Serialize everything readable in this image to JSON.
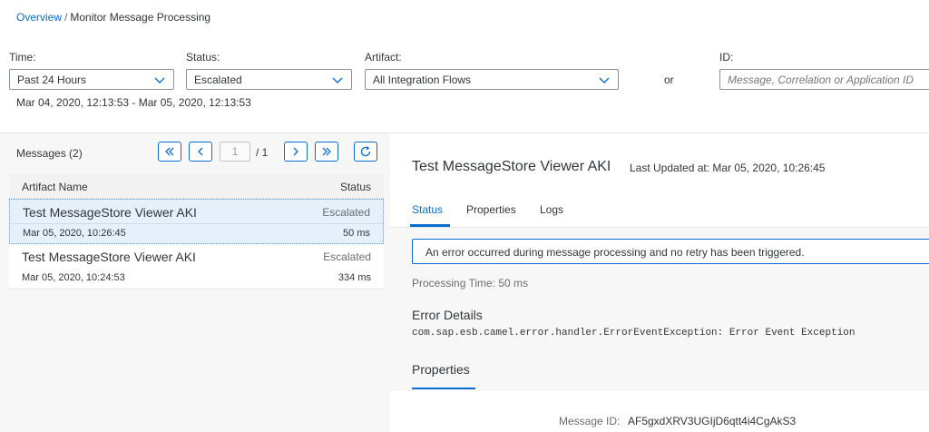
{
  "breadcrumb": {
    "overview": "Overview",
    "separator": "/",
    "current": "Monitor Message Processing"
  },
  "filters": {
    "time": {
      "label": "Time:",
      "value": "Past 24 Hours"
    },
    "status": {
      "label": "Status:",
      "value": "Escalated"
    },
    "artifact": {
      "label": "Artifact:",
      "value": "All Integration Flows"
    },
    "or_text": "or",
    "id": {
      "label": "ID:",
      "placeholder": "Message, Correlation or Application ID"
    },
    "date_range": "Mar 04, 2020, 12:13:53 - Mar 05, 2020, 12:13:53"
  },
  "messages": {
    "title": "Messages (2)",
    "pagination": {
      "current": "1",
      "total_text": "/ 1"
    },
    "columns": {
      "artifact": "Artifact Name",
      "status": "Status"
    },
    "rows": [
      {
        "name": "Test MessageStore Viewer AKI",
        "status": "Escalated",
        "date": "Mar 05, 2020, 10:26:45",
        "duration": "50 ms",
        "selected": true
      },
      {
        "name": "Test MessageStore Viewer AKI",
        "status": "Escalated",
        "date": "Mar 05, 2020, 10:24:53",
        "duration": "334 ms",
        "selected": false
      }
    ]
  },
  "detail": {
    "title": "Test MessageStore Viewer AKI",
    "last_updated": "Last Updated at: Mar 05, 2020, 10:26:45",
    "tabs": [
      "Status",
      "Properties",
      "Logs"
    ],
    "active_tab": "Status",
    "status_message": "An error occurred during message processing and no retry has been triggered.",
    "processing_time": "Processing Time: 50 ms",
    "error_heading": "Error Details",
    "error_text": "com.sap.esb.camel.error.handler.ErrorEventException: Error Event Exception",
    "properties_heading": "Properties",
    "message_id_label": "Message ID:",
    "message_id_value": "AF5gxdXRV3UGIjD6qtt4i4CgAkS3"
  },
  "colors": {
    "accent": "#0a6ed1",
    "selected_row": "#e5f0fa"
  },
  "icons": [
    "chevron-down-icon",
    "first-page-icon",
    "previous-page-icon",
    "next-page-icon",
    "last-page-icon",
    "refresh-icon"
  ]
}
